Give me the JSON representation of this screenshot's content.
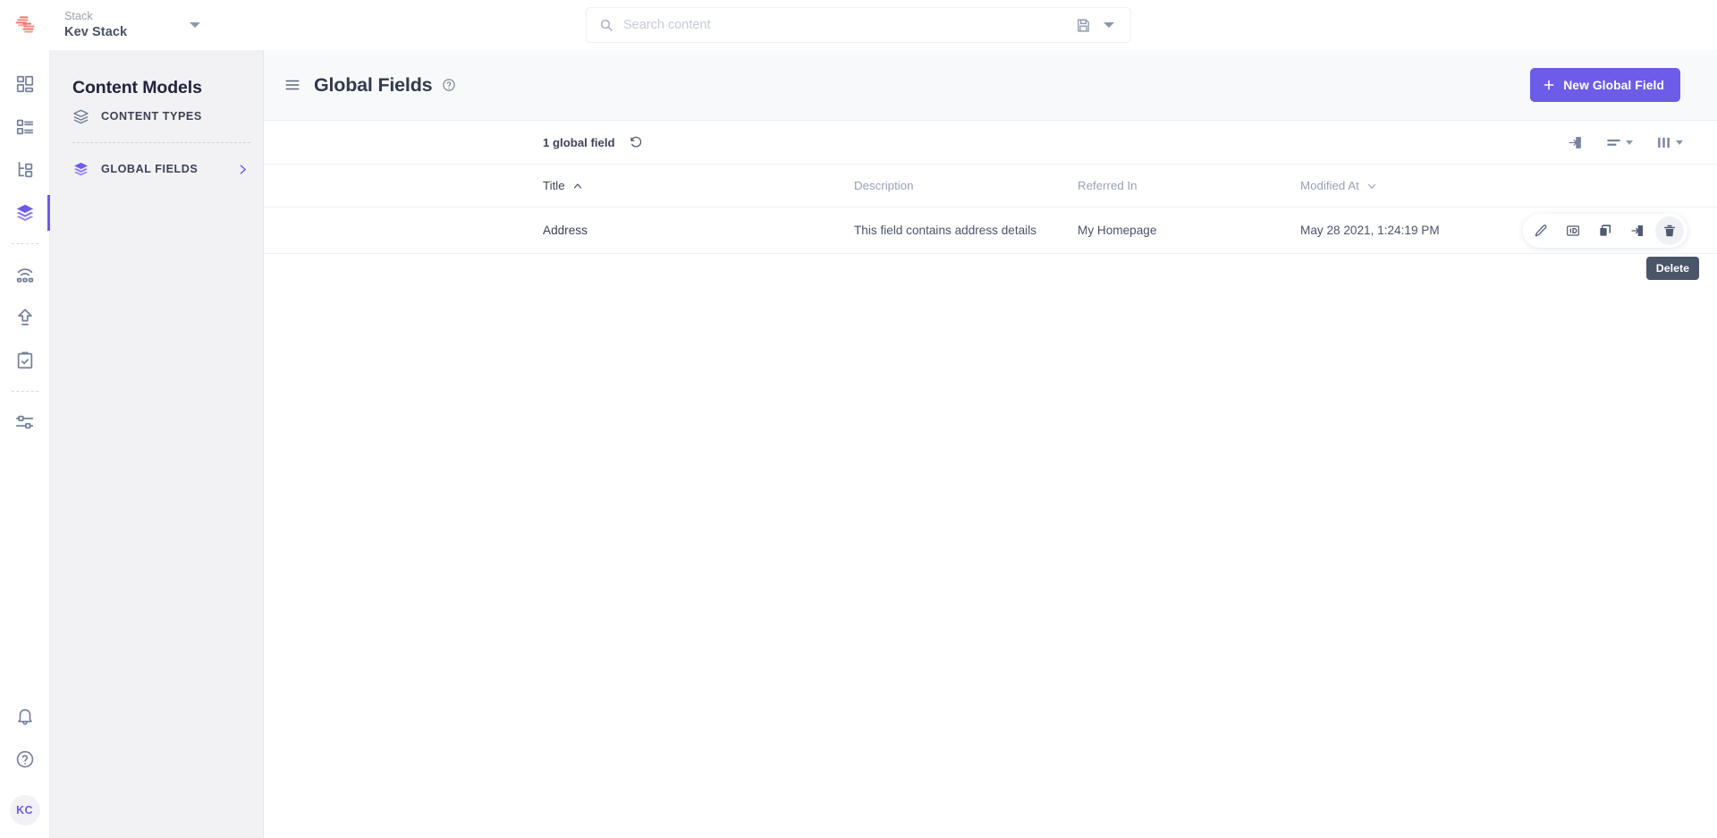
{
  "topbar": {
    "logo_icon": "contentstack-logo",
    "stack": {
      "label": "Stack",
      "name": "Kev Stack",
      "caret_icon": "chevron-down-icon"
    },
    "search": {
      "icon": "search-icon",
      "placeholder": "Search content",
      "value": "",
      "save_icon": "save-disk-icon",
      "caret_icon": "chevron-down-icon"
    }
  },
  "rail": {
    "items": [
      {
        "icon": "dashboard-icon",
        "name": "dashboard",
        "active": false
      },
      {
        "icon": "entries-list-icon",
        "name": "entries",
        "active": false
      },
      {
        "icon": "hierarchy-icon",
        "name": "hierarchy",
        "active": false
      },
      {
        "icon": "layers-icon",
        "name": "content-models",
        "active": true
      },
      {
        "icon": "wifi-stack-icon",
        "name": "publish-queue",
        "active": false
      },
      {
        "icon": "upload-icon",
        "name": "releases",
        "active": false
      },
      {
        "icon": "clipboard-check-icon",
        "name": "workflows",
        "active": false
      },
      {
        "icon": "sliders-icon",
        "name": "settings",
        "active": false
      }
    ],
    "bottom": [
      {
        "icon": "bell-icon",
        "name": "notifications"
      },
      {
        "icon": "help-circle-icon",
        "name": "help"
      }
    ],
    "avatar_initials": "KC"
  },
  "sidebar": {
    "title": "Content Models",
    "items": [
      {
        "label": "CONTENT TYPES",
        "icon": "layers-outline-icon",
        "active": false
      },
      {
        "label": "GLOBAL FIELDS",
        "icon": "layers-filled-icon",
        "active": true,
        "chevron": "chevron-right-icon"
      }
    ]
  },
  "page": {
    "menu_icon": "hamburger-icon",
    "title": "Global Fields",
    "help_icon": "help-circle-icon",
    "new_button": {
      "label": "New Global Field",
      "icon": "plus-icon",
      "color": "#6C5CE7"
    }
  },
  "toolbar": {
    "count_text": "1 global field",
    "refresh_icon": "refresh-undo-icon",
    "actions": [
      {
        "name": "export",
        "icon": "export-arrow-icon",
        "has_caret": false
      },
      {
        "name": "row-density",
        "icon": "row-density-icon",
        "has_caret": true
      },
      {
        "name": "column-selector",
        "icon": "columns-icon",
        "has_caret": true
      }
    ]
  },
  "table": {
    "columns": [
      {
        "label": "Title",
        "sort": "asc",
        "sort_icon": "chevron-up-icon",
        "sorted": true
      },
      {
        "label": "Description",
        "sort": "none",
        "sorted": false
      },
      {
        "label": "Referred In",
        "sort": "none",
        "sorted": false
      },
      {
        "label": "Modified At",
        "sort": "desc",
        "sort_icon": "chevron-down-icon",
        "sorted": false
      }
    ],
    "rows": [
      {
        "title": "Address",
        "description": "This field contains address details",
        "referred_in": "My Homepage",
        "modified_at": "May 28 2021, 1:24:19 PM"
      }
    ],
    "row_actions": [
      {
        "name": "edit",
        "icon": "pencil-icon",
        "hovered": false
      },
      {
        "name": "uid",
        "icon": "id-badge-icon",
        "hovered": false
      },
      {
        "name": "duplicate",
        "icon": "copy-icon",
        "hovered": false
      },
      {
        "name": "export",
        "icon": "export-arrow-icon",
        "hovered": false
      },
      {
        "name": "delete",
        "icon": "trash-icon",
        "hovered": true
      }
    ]
  },
  "tooltip": {
    "text": "Delete",
    "background": "#4A5568"
  }
}
